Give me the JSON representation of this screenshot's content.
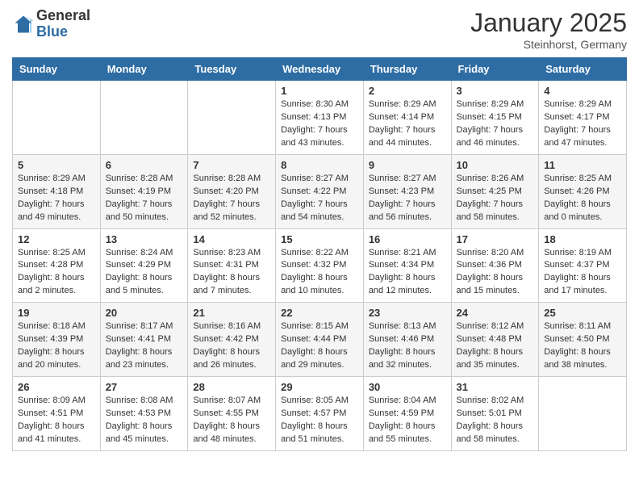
{
  "logo": {
    "general": "General",
    "blue": "Blue"
  },
  "header": {
    "month": "January 2025",
    "location": "Steinhorst, Germany"
  },
  "days_of_week": [
    "Sunday",
    "Monday",
    "Tuesday",
    "Wednesday",
    "Thursday",
    "Friday",
    "Saturday"
  ],
  "weeks": [
    [
      {
        "day": "",
        "info": ""
      },
      {
        "day": "",
        "info": ""
      },
      {
        "day": "",
        "info": ""
      },
      {
        "day": "1",
        "info": "Sunrise: 8:30 AM\nSunset: 4:13 PM\nDaylight: 7 hours\nand 43 minutes."
      },
      {
        "day": "2",
        "info": "Sunrise: 8:29 AM\nSunset: 4:14 PM\nDaylight: 7 hours\nand 44 minutes."
      },
      {
        "day": "3",
        "info": "Sunrise: 8:29 AM\nSunset: 4:15 PM\nDaylight: 7 hours\nand 46 minutes."
      },
      {
        "day": "4",
        "info": "Sunrise: 8:29 AM\nSunset: 4:17 PM\nDaylight: 7 hours\nand 47 minutes."
      }
    ],
    [
      {
        "day": "5",
        "info": "Sunrise: 8:29 AM\nSunset: 4:18 PM\nDaylight: 7 hours\nand 49 minutes."
      },
      {
        "day": "6",
        "info": "Sunrise: 8:28 AM\nSunset: 4:19 PM\nDaylight: 7 hours\nand 50 minutes."
      },
      {
        "day": "7",
        "info": "Sunrise: 8:28 AM\nSunset: 4:20 PM\nDaylight: 7 hours\nand 52 minutes."
      },
      {
        "day": "8",
        "info": "Sunrise: 8:27 AM\nSunset: 4:22 PM\nDaylight: 7 hours\nand 54 minutes."
      },
      {
        "day": "9",
        "info": "Sunrise: 8:27 AM\nSunset: 4:23 PM\nDaylight: 7 hours\nand 56 minutes."
      },
      {
        "day": "10",
        "info": "Sunrise: 8:26 AM\nSunset: 4:25 PM\nDaylight: 7 hours\nand 58 minutes."
      },
      {
        "day": "11",
        "info": "Sunrise: 8:25 AM\nSunset: 4:26 PM\nDaylight: 8 hours\nand 0 minutes."
      }
    ],
    [
      {
        "day": "12",
        "info": "Sunrise: 8:25 AM\nSunset: 4:28 PM\nDaylight: 8 hours\nand 2 minutes."
      },
      {
        "day": "13",
        "info": "Sunrise: 8:24 AM\nSunset: 4:29 PM\nDaylight: 8 hours\nand 5 minutes."
      },
      {
        "day": "14",
        "info": "Sunrise: 8:23 AM\nSunset: 4:31 PM\nDaylight: 8 hours\nand 7 minutes."
      },
      {
        "day": "15",
        "info": "Sunrise: 8:22 AM\nSunset: 4:32 PM\nDaylight: 8 hours\nand 10 minutes."
      },
      {
        "day": "16",
        "info": "Sunrise: 8:21 AM\nSunset: 4:34 PM\nDaylight: 8 hours\nand 12 minutes."
      },
      {
        "day": "17",
        "info": "Sunrise: 8:20 AM\nSunset: 4:36 PM\nDaylight: 8 hours\nand 15 minutes."
      },
      {
        "day": "18",
        "info": "Sunrise: 8:19 AM\nSunset: 4:37 PM\nDaylight: 8 hours\nand 17 minutes."
      }
    ],
    [
      {
        "day": "19",
        "info": "Sunrise: 8:18 AM\nSunset: 4:39 PM\nDaylight: 8 hours\nand 20 minutes."
      },
      {
        "day": "20",
        "info": "Sunrise: 8:17 AM\nSunset: 4:41 PM\nDaylight: 8 hours\nand 23 minutes."
      },
      {
        "day": "21",
        "info": "Sunrise: 8:16 AM\nSunset: 4:42 PM\nDaylight: 8 hours\nand 26 minutes."
      },
      {
        "day": "22",
        "info": "Sunrise: 8:15 AM\nSunset: 4:44 PM\nDaylight: 8 hours\nand 29 minutes."
      },
      {
        "day": "23",
        "info": "Sunrise: 8:13 AM\nSunset: 4:46 PM\nDaylight: 8 hours\nand 32 minutes."
      },
      {
        "day": "24",
        "info": "Sunrise: 8:12 AM\nSunset: 4:48 PM\nDaylight: 8 hours\nand 35 minutes."
      },
      {
        "day": "25",
        "info": "Sunrise: 8:11 AM\nSunset: 4:50 PM\nDaylight: 8 hours\nand 38 minutes."
      }
    ],
    [
      {
        "day": "26",
        "info": "Sunrise: 8:09 AM\nSunset: 4:51 PM\nDaylight: 8 hours\nand 41 minutes."
      },
      {
        "day": "27",
        "info": "Sunrise: 8:08 AM\nSunset: 4:53 PM\nDaylight: 8 hours\nand 45 minutes."
      },
      {
        "day": "28",
        "info": "Sunrise: 8:07 AM\nSunset: 4:55 PM\nDaylight: 8 hours\nand 48 minutes."
      },
      {
        "day": "29",
        "info": "Sunrise: 8:05 AM\nSunset: 4:57 PM\nDaylight: 8 hours\nand 51 minutes."
      },
      {
        "day": "30",
        "info": "Sunrise: 8:04 AM\nSunset: 4:59 PM\nDaylight: 8 hours\nand 55 minutes."
      },
      {
        "day": "31",
        "info": "Sunrise: 8:02 AM\nSunset: 5:01 PM\nDaylight: 8 hours\nand 58 minutes."
      },
      {
        "day": "",
        "info": ""
      }
    ]
  ]
}
